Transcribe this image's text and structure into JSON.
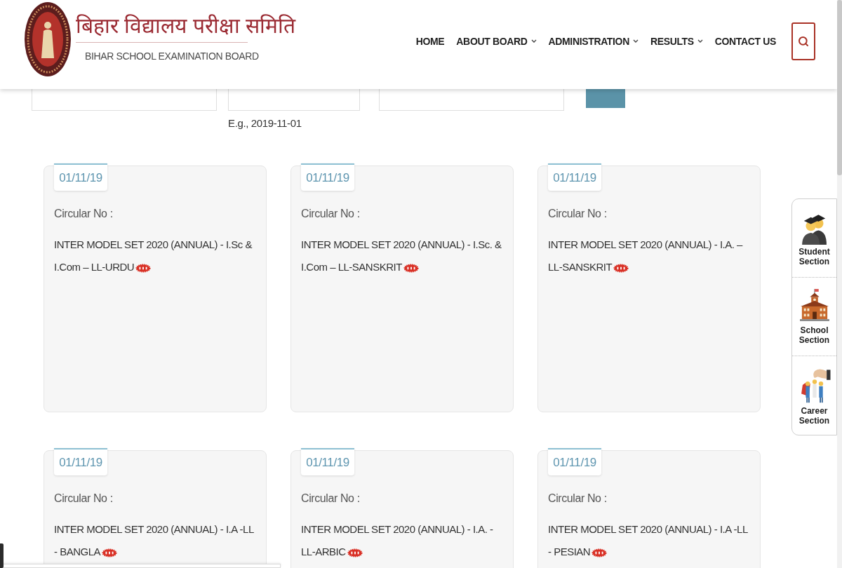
{
  "header": {
    "title_hindi": "बिहार विद्यालय परीक्षा समिति",
    "title_english": "BIHAR SCHOOL EXAMINATION BOARD"
  },
  "nav": [
    {
      "label": "HOME",
      "dropdown": false
    },
    {
      "label": "ABOUT BOARD",
      "dropdown": true
    },
    {
      "label": "ADMINISTRATION",
      "dropdown": true
    },
    {
      "label": "RESULTS",
      "dropdown": true
    },
    {
      "label": "CONTACT US",
      "dropdown": false
    }
  ],
  "filter_form": {
    "date_hint": "E.g., 2019-11-01"
  },
  "circulars": [
    {
      "date": "01/11/19",
      "label": "Circular No :",
      "title": "INTER MODEL SET 2020 (ANNUAL) - I.Sc & I.Com – LL-URDU",
      "new": true
    },
    {
      "date": "01/11/19",
      "label": "Circular No :",
      "title": "INTER MODEL SET 2020 (ANNUAL) - I.Sc. & I.Com – LL-SANSKRIT",
      "new": true
    },
    {
      "date": "01/11/19",
      "label": "Circular No :",
      "title": "INTER MODEL SET 2020 (ANNUAL) - I.A. – LL-SANSKRIT",
      "new": true
    },
    {
      "date": "01/11/19",
      "label": "Circular No :",
      "title": "INTER MODEL SET 2020 (ANNUAL) - I.A -LL - BANGLA",
      "new": true
    },
    {
      "date": "01/11/19",
      "label": "Circular No :",
      "title": "INTER MODEL SET 2020 (ANNUAL) - I.A. - LL-ARBIC",
      "new": true
    },
    {
      "date": "01/11/19",
      "label": "Circular No :",
      "title": "INTER MODEL SET 2020 (ANNUAL) - I.A -LL - PESIAN",
      "new": true
    }
  ],
  "side_tabs": [
    {
      "kind": "student",
      "label": "Student Section"
    },
    {
      "kind": "school",
      "label": "School Section"
    },
    {
      "kind": "career",
      "label": "Career Section"
    }
  ]
}
